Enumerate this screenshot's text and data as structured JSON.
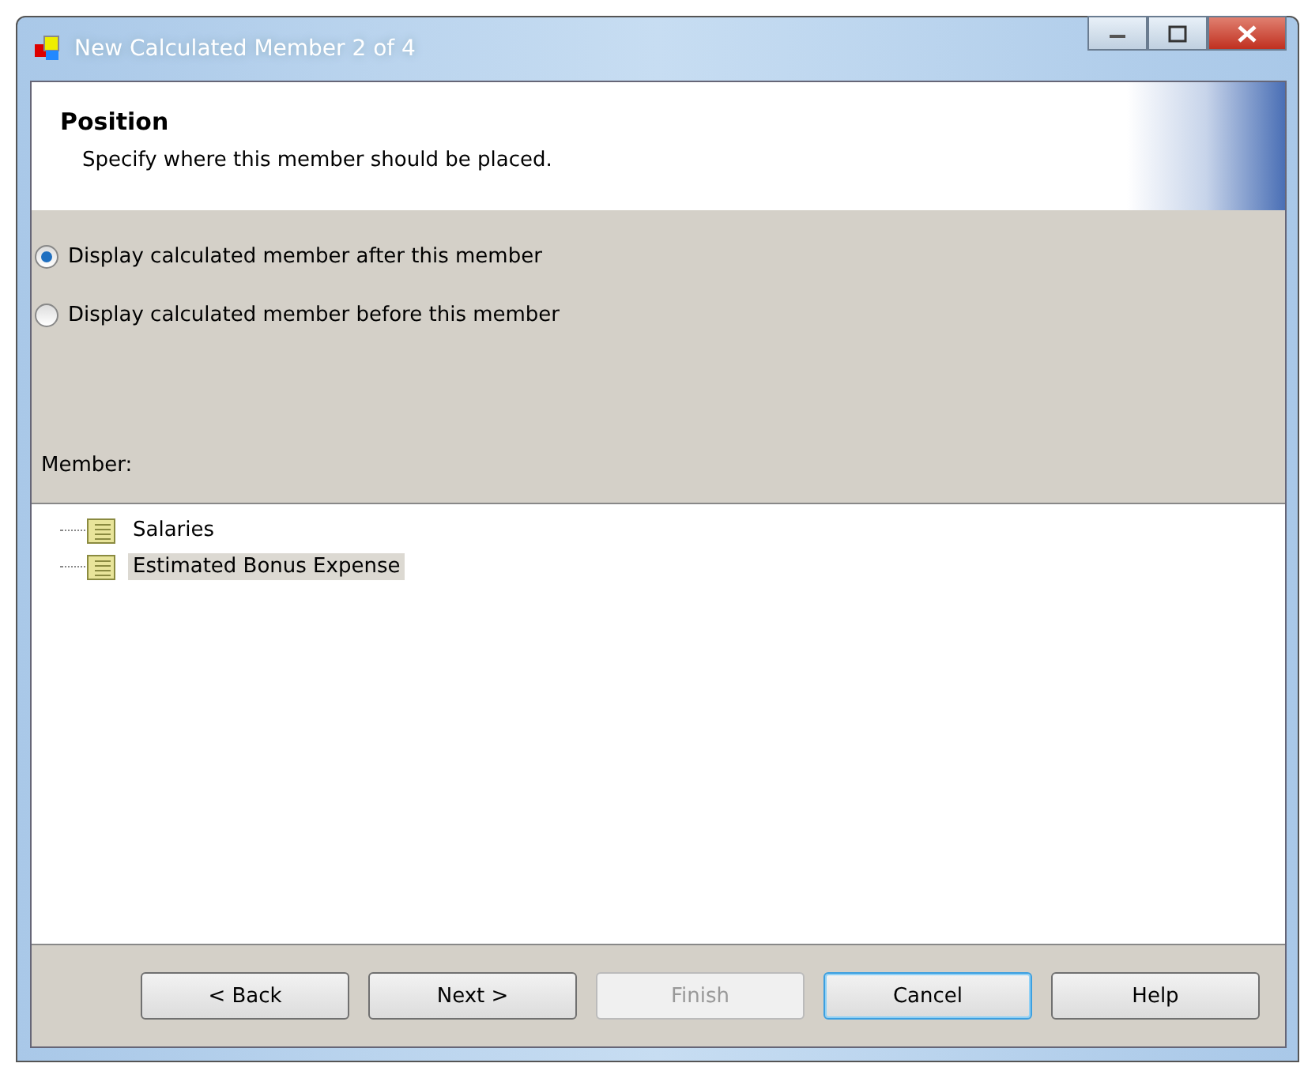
{
  "window": {
    "title": "New Calculated Member 2 of 4"
  },
  "header": {
    "title": "Position",
    "subtitle": "Specify where this member should be placed."
  },
  "options": [
    {
      "label": "Display calculated member after this member",
      "selected": true
    },
    {
      "label": "Display calculated member before this member",
      "selected": false
    }
  ],
  "member_label": "Member:",
  "tree": [
    {
      "label": "Salaries",
      "selected": false
    },
    {
      "label": "Estimated Bonus Expense",
      "selected": true
    }
  ],
  "buttons": [
    {
      "label": "< Back",
      "disabled": false,
      "focused": false
    },
    {
      "label": "Next >",
      "disabled": false,
      "focused": false
    },
    {
      "label": "Finish",
      "disabled": true,
      "focused": false
    },
    {
      "label": "Cancel",
      "disabled": false,
      "focused": true
    },
    {
      "label": "Help",
      "disabled": false,
      "focused": false
    }
  ]
}
